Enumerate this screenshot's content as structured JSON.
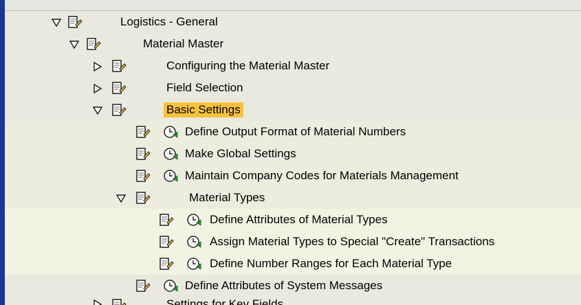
{
  "tree": {
    "rows": [
      {
        "label": "Logistics - General",
        "expander": "expanded",
        "icons": [
          "document-icon"
        ]
      },
      {
        "label": "Material Master",
        "expander": "expanded",
        "icons": [
          "document-icon"
        ]
      },
      {
        "label": "Configuring the Material Master",
        "expander": "collapsed",
        "icons": [
          "document-icon"
        ]
      },
      {
        "label": "Field Selection",
        "expander": "collapsed",
        "icons": [
          "document-icon"
        ]
      },
      {
        "label": "Basic Settings",
        "expander": "expanded",
        "icons": [
          "document-icon"
        ],
        "selected": true
      },
      {
        "label": "Define Output Format of Material Numbers",
        "expander": "none",
        "icons": [
          "document-icon",
          "execute-clock-icon"
        ]
      },
      {
        "label": "Make Global Settings",
        "expander": "none",
        "icons": [
          "document-icon",
          "execute-clock-icon"
        ]
      },
      {
        "label": "Maintain Company Codes for Materials Management",
        "expander": "none",
        "icons": [
          "document-icon",
          "execute-clock-icon"
        ]
      },
      {
        "label": "Material Types",
        "expander": "expanded",
        "icons": [
          "document-icon"
        ]
      },
      {
        "label": "Define Attributes of Material Types",
        "expander": "none",
        "icons": [
          "document-icon",
          "execute-clock-icon"
        ]
      },
      {
        "label": "Assign Material Types to Special \"Create\" Transactions",
        "expander": "none",
        "icons": [
          "document-icon",
          "execute-clock-icon"
        ]
      },
      {
        "label": "Define Number Ranges for Each Material Type",
        "expander": "none",
        "icons": [
          "document-icon",
          "execute-clock-icon"
        ]
      },
      {
        "label": "Define Attributes of System Messages",
        "expander": "none",
        "icons": [
          "document-icon",
          "execute-clock-icon"
        ]
      },
      {
        "label": "Settings for Key Fields",
        "expander": "collapsed",
        "icons": [
          "document-icon"
        ]
      }
    ]
  },
  "colors": {
    "left_border": "#16379c",
    "selected_highlight": "#f6c33a",
    "clock_green": "#2f8f2f"
  }
}
